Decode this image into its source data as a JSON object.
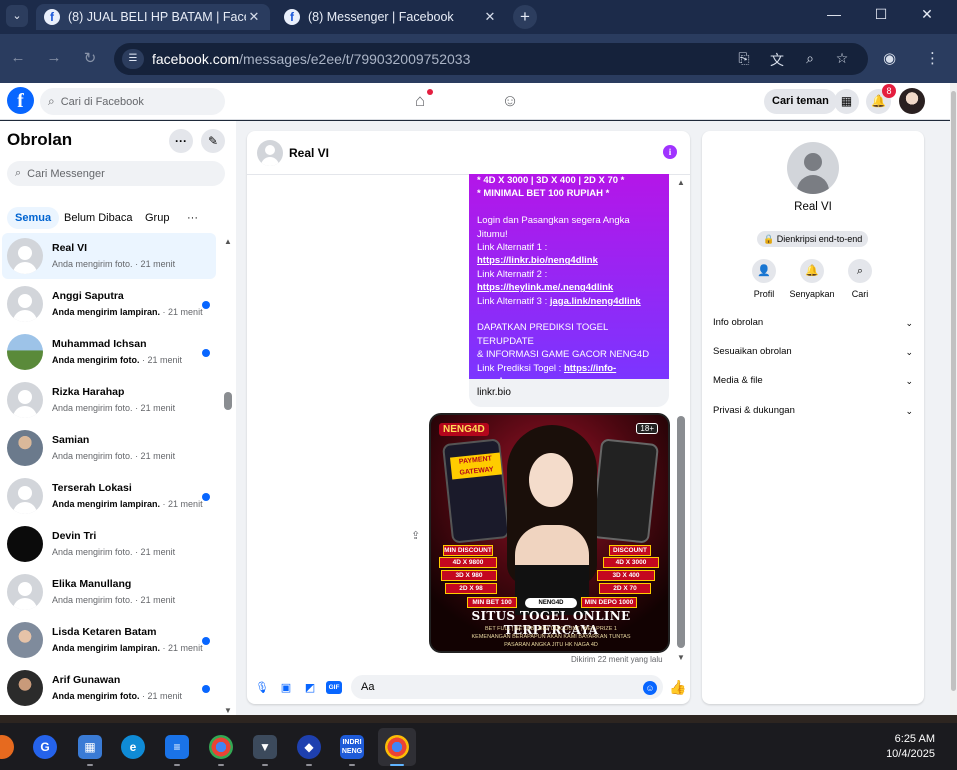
{
  "browser": {
    "tabs": [
      {
        "title": "(8) JUAL BELI HP BATAM | Faceb",
        "active": true
      },
      {
        "title": "(8) Messenger | Facebook",
        "active": false
      }
    ],
    "url_host": "facebook.com",
    "url_path": "/messages/e2ee/t/799032009752033"
  },
  "fb_header": {
    "search_placeholder": "Cari di Facebook",
    "find_friends": "Cari teman",
    "notification_count": "8"
  },
  "sidebar": {
    "title": "Obrolan",
    "search_placeholder": "Cari Messenger",
    "filters": [
      "Semua",
      "Belum Dibaca",
      "Grup"
    ],
    "chats": [
      {
        "name": "Real VI",
        "prefix": "",
        "preview": "Anda mengirim foto.",
        "time": "· 21 menit",
        "unread": false,
        "selected": true
      },
      {
        "name": "Anggi Saputra",
        "prefix": "Anda mengirim lampiran.",
        "preview": "",
        "time": "· 21 menit",
        "unread": true,
        "selected": false
      },
      {
        "name": "Muhammad Ichsan",
        "prefix": "Anda mengirim foto.",
        "preview": "",
        "time": "· 21 menit",
        "unread": true,
        "selected": false
      },
      {
        "name": "Rizka Harahap",
        "prefix": "",
        "preview": "Anda mengirim foto.",
        "time": "· 21 menit",
        "unread": false,
        "selected": false
      },
      {
        "name": "Samian",
        "prefix": "",
        "preview": "Anda mengirim foto.",
        "time": "· 21 menit",
        "unread": false,
        "selected": false
      },
      {
        "name": "Terserah Lokasi",
        "prefix": "Anda mengirim lampiran.",
        "preview": "",
        "time": "· 21 menit",
        "unread": true,
        "selected": false
      },
      {
        "name": "Devin Tri",
        "prefix": "",
        "preview": "Anda mengirim foto.",
        "time": "· 21 menit",
        "unread": false,
        "selected": false
      },
      {
        "name": "Elika Manullang",
        "prefix": "",
        "preview": "Anda mengirim foto.",
        "time": "· 21 menit",
        "unread": false,
        "selected": false
      },
      {
        "name": "Lisda Ketaren Batam",
        "prefix": "Anda mengirim lampiran.",
        "preview": "",
        "time": "· 21 menit",
        "unread": true,
        "selected": false
      },
      {
        "name": "Arif Gunawan",
        "prefix": "Anda mengirim foto.",
        "preview": "",
        "time": "· 21 menit",
        "unread": true,
        "selected": false
      }
    ]
  },
  "conversation": {
    "contact_name": "Real VI",
    "message": {
      "promo_1": "* 4D X 3000 | 3D X 400 | 2D X 70 *",
      "promo_2": "* MINIMAL BET 100 RUPIAH *",
      "intro_1": "Login dan Pasangkan segera Angka",
      "intro_2": "Jitumu!",
      "alt1_label": "Link Alternatif 1 :",
      "alt1_url": "https://linkr.bio/neng4dlink",
      "alt2_label": "Link Alternatif 2 :",
      "alt2_url": "https://heylink.me/.neng4dlink",
      "alt3_label": "Link Alternatif 3 :",
      "alt3_url": "jaga.link/neng4dlink",
      "predict_1": "DAPATKAN PREDIKSI TOGEL TERUPDATE",
      "predict_2": "& INFORMASI GAME GACOR NENG4D",
      "predict_label": "Link Prediksi Togel :",
      "predict_url_1": "https://info-",
      "predict_url_2": "ramalan.com",
      "link_preview": "linkr.bio"
    },
    "image": {
      "brand": "NENG4D",
      "age": "18+",
      "gateway": "PAYMENT GATEWAY",
      "tags_left": [
        "MIN DISCOUNT",
        "4D X 9800",
        "3D X 980",
        "2D X 98",
        "MIN BET 100"
      ],
      "tags_right": [
        "DISCOUNT",
        "4D X 3000",
        "3D X 400",
        "2D X 70",
        "MIN DEPO 1000"
      ],
      "search_label": "NENG4D",
      "headline": "SITUS TOGEL ONLINE TERPERCAYA",
      "line_1": "BET FULL | BET BB | BET DISCOUNT | BET PRIZE 1",
      "line_2": "KEMENANGAN BERAPAPUN AKAN KAMI BAYARKAN TUNTAS",
      "line_3": "PASARAN ANGKA JITU HK NAGA 4D"
    },
    "sent_status": "Dikirim 22 menit yang lalu",
    "composer_value": "Aa"
  },
  "info_panel": {
    "name": "Real VI",
    "e2e": "Dienkripsi end-to-end",
    "actions": [
      {
        "label": "Profil",
        "icon": "person-icon"
      },
      {
        "label": "Senyapkan",
        "icon": "bell-icon"
      },
      {
        "label": "Cari",
        "icon": "search-icon"
      }
    ],
    "sections": [
      "Info obrolan",
      "Sesuaikan obrolan",
      "Media & file",
      "Privasi & dukungan"
    ]
  },
  "taskbar": {
    "time": "6:25 AM",
    "date": "10/4/2025",
    "indri_label": "INDRI NENG"
  },
  "colors": {
    "fb_blue": "#0866ff",
    "message_gradient_top": "#b416e8",
    "message_gradient_bottom": "#7b35ff",
    "unread_dot": "#0866ff"
  }
}
